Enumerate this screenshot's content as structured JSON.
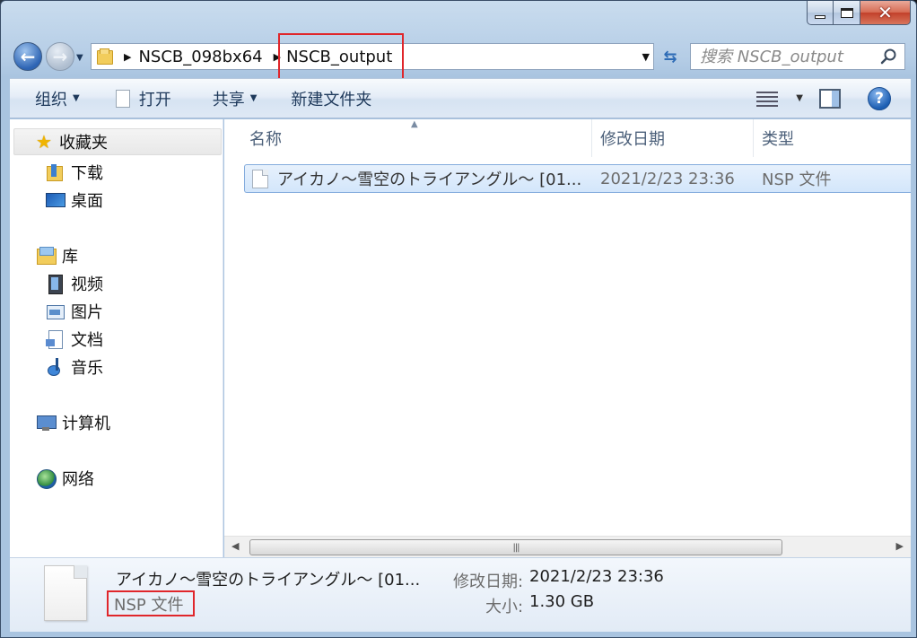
{
  "window": {
    "caption": {
      "minimize": "minimize",
      "maximize": "maximize",
      "close": "✕"
    }
  },
  "address": {
    "crumbs": [
      "NSCB_098bx64",
      "NSCB_output"
    ],
    "dropdown": "▼",
    "search_placeholder": "搜索 NSCB_output"
  },
  "toolbar": {
    "organize": "组织",
    "open": "打开",
    "share": "共享",
    "new_folder": "新建文件夹",
    "help": "?"
  },
  "nav": {
    "favorites": "收藏夹",
    "downloads": "下载",
    "desktop": "桌面",
    "libraries": "库",
    "videos": "视频",
    "pictures": "图片",
    "documents": "文档",
    "music": "音乐",
    "computer": "计算机",
    "network": "网络"
  },
  "columns": {
    "name": "名称",
    "modified": "修改日期",
    "type": "类型"
  },
  "files": [
    {
      "name": "アイカノ〜雪空のトライアングル〜 [01...",
      "modified": "2021/2/23 23:36",
      "type": "NSP 文件"
    }
  ],
  "details": {
    "name": "アイカノ〜雪空のトライアングル〜 [01...",
    "type": "NSP 文件",
    "modified_label": "修改日期:",
    "modified_value": "2021/2/23 23:36",
    "size_label": "大小:",
    "size_value": "1.30 GB"
  },
  "colors": {
    "highlight": "#e0262b",
    "selection": "#d3e6fb"
  },
  "icons": {
    "back": "back-arrow-icon",
    "forward": "forward-arrow-icon",
    "refresh": "refresh-icon",
    "search": "search-icon"
  }
}
